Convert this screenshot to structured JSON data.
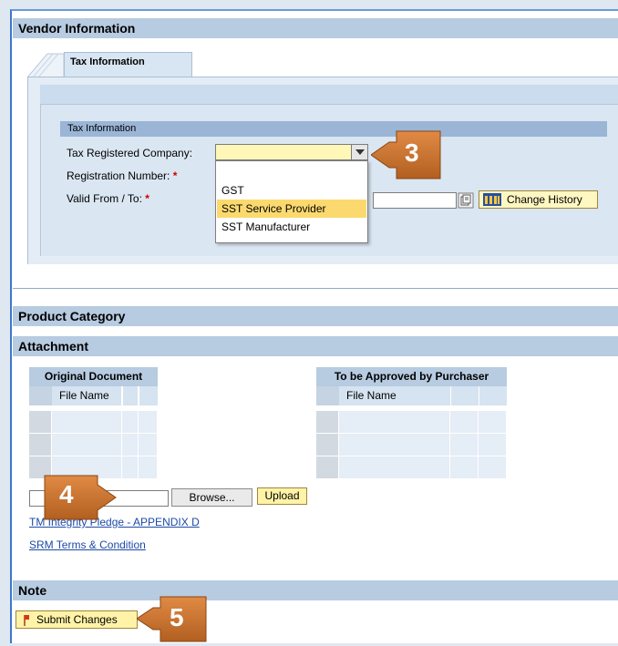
{
  "vendor_section": {
    "title": "Vendor Information"
  },
  "tabs": [
    {
      "label": "Tax Information"
    }
  ],
  "tax_group": {
    "title": "Tax Information"
  },
  "fields": {
    "tax_company_label": "Tax Registered Company:",
    "reg_number_label": "Registration Number:",
    "valid_label": "Valid From / To:",
    "required_mark": "*"
  },
  "tax_company_dropdown": {
    "options": [
      "GST",
      "SST Service Provider",
      "SST Manufacturer"
    ],
    "highlighted": "SST Service Provider"
  },
  "buttons": {
    "change_history": "Change History",
    "browse": "Browse...",
    "upload": "Upload",
    "submit_changes": "Submit Changes"
  },
  "product_section": {
    "title": "Product Category"
  },
  "attachment_section": {
    "title": "Attachment"
  },
  "tables": {
    "original": {
      "title": "Original Document",
      "column": "File Name"
    },
    "approval": {
      "title": "To be Approved by Purchaser",
      "column": "File Name"
    }
  },
  "links": {
    "pledge": "TM Integrity Pledge - APPENDIX D",
    "terms": "SRM Terms & Condition"
  },
  "note_section": {
    "title": "Note"
  },
  "callouts": [
    "3",
    "4",
    "5"
  ],
  "colors": {
    "callout": "#c9732d",
    "section_header": "#b7cbe1",
    "highlight": "#fbd96e",
    "required": "#d00000"
  }
}
